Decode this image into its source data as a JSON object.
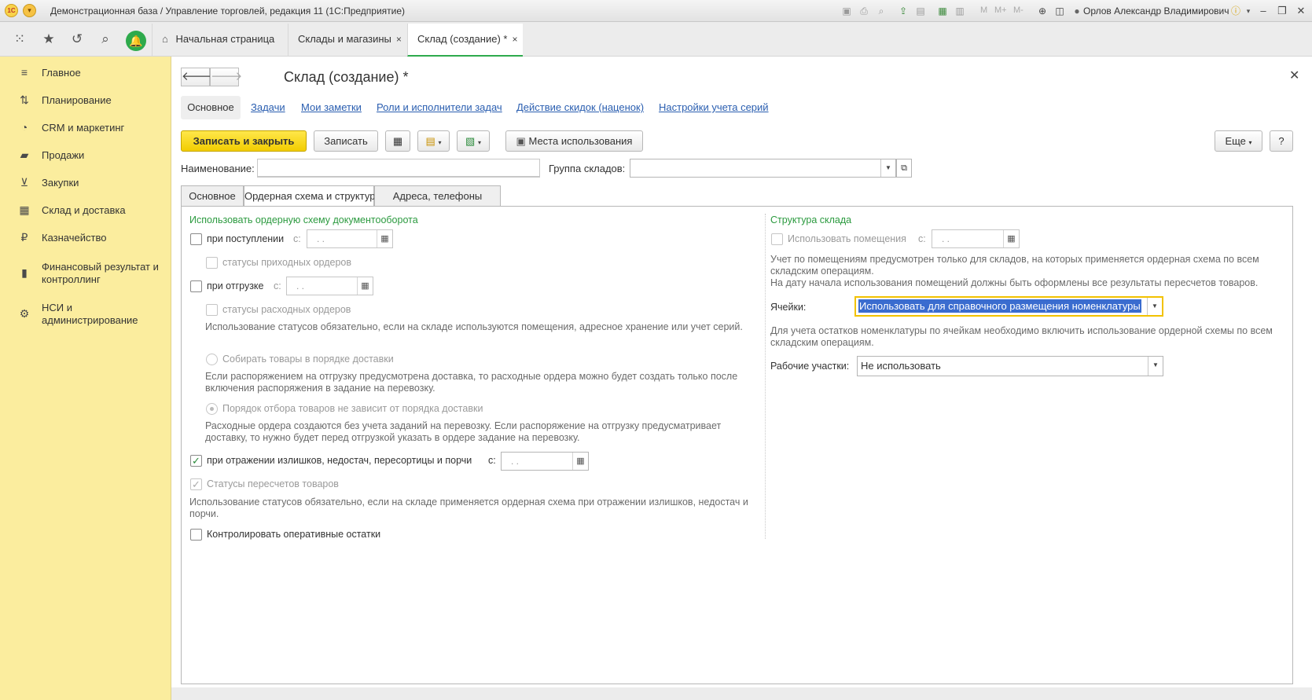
{
  "window": {
    "title": "Демонстрационная база / Управление торговлей, редакция 11  (1С:Предприятие)",
    "logo_text": "1С",
    "memory_buttons": [
      "M",
      "M+",
      "M-"
    ],
    "user": "Орлов Александр Владимирович"
  },
  "tabs": [
    {
      "label": "Начальная страница"
    },
    {
      "label": "Склады и магазины",
      "close": "×"
    },
    {
      "label": "Склад (создание) *",
      "close": "×"
    }
  ],
  "sidebar": {
    "items": [
      {
        "label": "Главное",
        "icon": "menu-icon"
      },
      {
        "label": "Планирование",
        "icon": "planning-icon"
      },
      {
        "label": "CRM и маркетинг",
        "icon": "pie-chart-icon"
      },
      {
        "label": "Продажи",
        "icon": "bag-icon"
      },
      {
        "label": "Закупки",
        "icon": "cart-icon"
      },
      {
        "label": "Склад и доставка",
        "icon": "warehouse-icon"
      },
      {
        "label": "Казначейство",
        "icon": "ruble-icon"
      },
      {
        "label": "Финансовый результат и контроллинг",
        "icon": "bar-chart-icon"
      },
      {
        "label": "НСИ и администрирование",
        "icon": "gear-icon"
      }
    ]
  },
  "form": {
    "title": "Склад (создание) *",
    "sections": [
      "Основное",
      "Задачи",
      "Мои заметки",
      "Роли и исполнители задач",
      "Действие скидок (наценок)",
      "Настройки учета серий"
    ],
    "toolbar": {
      "save_close": "Записать и закрыть",
      "save": "Записать",
      "usage": "Места использования",
      "more": "Еще",
      "help": "?"
    },
    "name_label": "Наименование:",
    "name_value": "",
    "group_label": "Группа складов:",
    "group_value": "",
    "tabs": [
      "Основное",
      "Ордерная схема и структура",
      "Адреса, телефоны"
    ]
  },
  "order_scheme": {
    "header": "Использовать ордерную схему документооборота",
    "receipt": {
      "label": "при поступлении",
      "checked": false,
      "date_label": "с:",
      "date": " .  ."
    },
    "receipt_status": {
      "label": "статусы приходных ордеров",
      "checked": false
    },
    "shipment": {
      "label": "при отгрузке",
      "checked": false,
      "date_label": "с:",
      "date": " .  ."
    },
    "shipment_status": {
      "label": "статусы расходных ордеров",
      "checked": false
    },
    "status_note": "Использование статусов обязательно, если на складе используются помещения, адресное хранение или учет серий.",
    "radio1": {
      "label": "Собирать товары в порядке доставки",
      "selected": false
    },
    "radio1_note": "Если распоряжением на отгрузку предусмотрена доставка, то расходные ордера можно будет создать только после включения распоряжения в задание на перевозку.",
    "radio2": {
      "label": "Порядок отбора товаров не зависит от порядка доставки",
      "selected": true
    },
    "radio2_note": "Расходные ордера создаются без учета заданий на перевозку. Если распоряжение на отгрузку предусматривает доставку, то нужно будет перед отгрузкой указать в ордере задание на перевозку.",
    "surplus": {
      "label": "при отражении излишков, недостач, пересортицы и порчи",
      "checked": true,
      "date_label": "с:",
      "date": " .  ."
    },
    "recount_status": {
      "label": "Статусы пересчетов товаров",
      "checked": true
    },
    "recount_note": "Использование статусов обязательно, если на складе применяется ордерная схема при отражении излишков, недостач и порчи.",
    "control_stock": {
      "label": "Контролировать оперативные остатки",
      "checked": false
    }
  },
  "structure": {
    "header": "Структура склада",
    "use_rooms": {
      "label": "Использовать помещения",
      "checked": false,
      "date_label": "с:",
      "date": " .  ."
    },
    "rooms_note": "Учет по помещениям предусмотрен только для складов, на которых применяется ордерная схема по всем складским операциям.\nНа дату начала использования помещений должны быть оформлены все результаты пересчетов товаров.",
    "cells_label": "Ячейки:",
    "cells_value": "Использовать для справочного размещения номенклатуры",
    "cells_note": "Для учета остатков номенклатуры по ячейкам необходимо включить использование ордерной схемы по всем складским операциям.",
    "workplaces_label": "Рабочие участки:",
    "workplaces_value": "Не использовать"
  },
  "colors": {
    "accent_green": "#2eaa4c",
    "sidebar_yellow": "#fbed9e",
    "primary_button": "#f2cd00",
    "link_blue": "#2a5eb0"
  }
}
